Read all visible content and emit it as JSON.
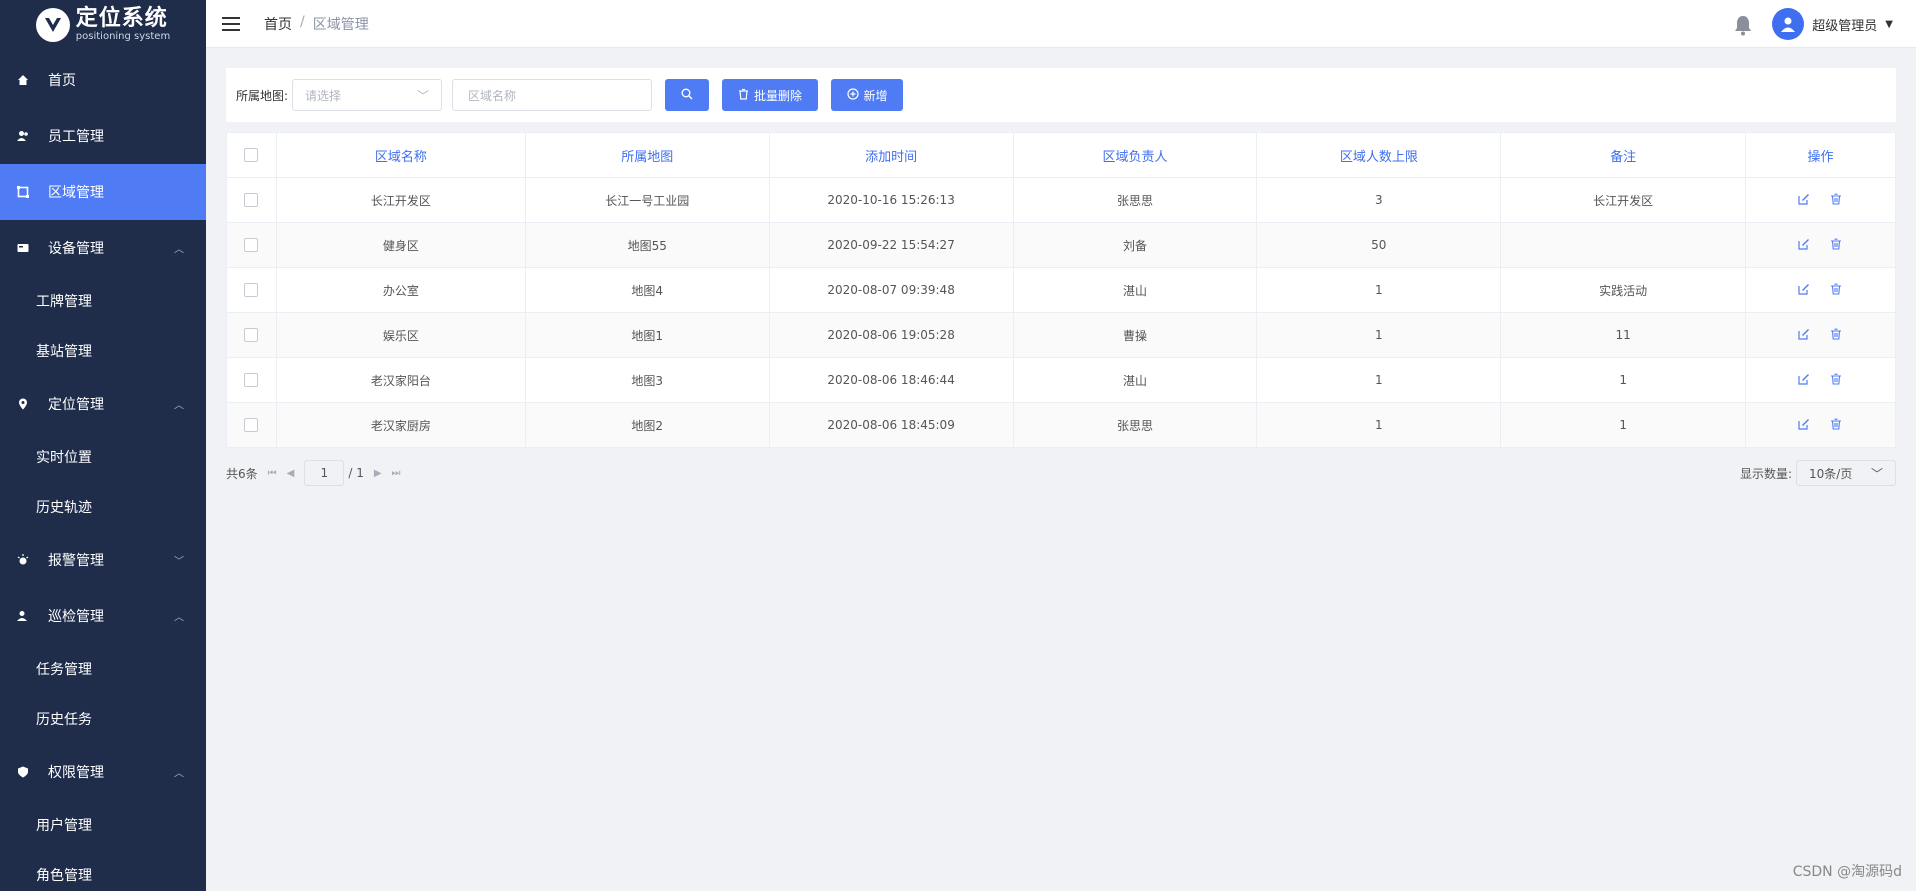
{
  "brand": {
    "title": "定位系统",
    "subtitle": "positioning system"
  },
  "sidebar": {
    "items": [
      {
        "label": "首页",
        "icon": "home-icon"
      },
      {
        "label": "员工管理",
        "icon": "users-icon"
      },
      {
        "label": "区域管理",
        "icon": "area-icon",
        "active": true
      },
      {
        "label": "设备管理",
        "icon": "device-icon",
        "expanded": true,
        "children": [
          "工牌管理",
          "基站管理"
        ]
      },
      {
        "label": "定位管理",
        "icon": "location-icon",
        "expanded": true,
        "children": [
          "实时位置",
          "历史轨迹"
        ]
      },
      {
        "label": "报警管理",
        "icon": "alarm-icon",
        "expanded": false
      },
      {
        "label": "巡检管理",
        "icon": "inspection-icon",
        "expanded": true,
        "children": [
          "任务管理",
          "历史任务"
        ]
      },
      {
        "label": "权限管理",
        "icon": "shield-icon",
        "expanded": true,
        "children": [
          "用户管理",
          "角色管理"
        ]
      }
    ]
  },
  "header": {
    "breadcrumb_home": "首页",
    "breadcrumb_sep": "/",
    "breadcrumb_current": "区域管理",
    "user_name": "超级管理员"
  },
  "filter": {
    "map_label": "所属地图:",
    "map_placeholder": "请选择",
    "name_placeholder": "区域名称",
    "batch_delete_label": "批量删除",
    "add_label": "新增"
  },
  "table": {
    "columns": [
      "区域名称",
      "所属地图",
      "添加时间",
      "区域负责人",
      "区域人数上限",
      "备注",
      "操作"
    ],
    "rows": [
      [
        "长江开发区",
        "长江一号工业园",
        "2020-10-16 15:26:13",
        "张思思",
        "3",
        "长江开发区"
      ],
      [
        "健身区",
        "地图55",
        "2020-09-22 15:54:27",
        "刘备",
        "50",
        ""
      ],
      [
        "办公室",
        "地图4",
        "2020-08-07 09:39:48",
        "湛山",
        "1",
        "实践活动"
      ],
      [
        "娱乐区",
        "地图1",
        "2020-08-06 19:05:28",
        "曹操",
        "1",
        "11"
      ],
      [
        "老汉家阳台",
        "地图3",
        "2020-08-06 18:46:44",
        "湛山",
        "1",
        "1"
      ],
      [
        "老汉家厨房",
        "地图2",
        "2020-08-06 18:45:09",
        "张思思",
        "1",
        "1"
      ]
    ]
  },
  "pager": {
    "total_text": "共6条",
    "current_page": "1",
    "total_pages_text": "/ 1",
    "size_label": "显示数量:",
    "size_value": "10条/页"
  },
  "watermark": "CSDN @淘源码d",
  "colors": {
    "sidebar_bg": "#1f2d4b",
    "accent": "#4f7cf5"
  }
}
